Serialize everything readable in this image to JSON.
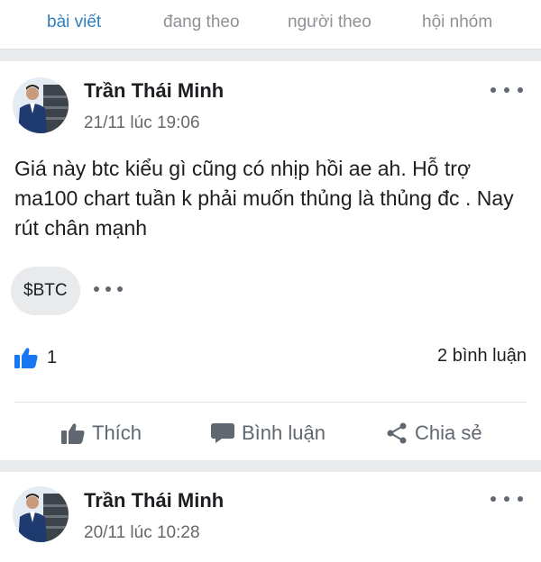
{
  "tabs": [
    {
      "label": "bài viết",
      "active": true
    },
    {
      "label": "đang theo",
      "active": false
    },
    {
      "label": "người theo",
      "active": false
    },
    {
      "label": "hội nhóm",
      "active": false
    }
  ],
  "posts": [
    {
      "author": "Trần Thái Minh",
      "timestamp": "21/11 lúc 19:06",
      "text": "Giá này btc kiểu gì cũng có nhịp hồi ae ah. Hỗ trợ ma100 chart tuần k phải muốn thủng là thủng đc . Nay rút chân mạnh",
      "tag": "$BTC",
      "like_count": "1",
      "comment_count": "2 bình luận"
    },
    {
      "author": "Trần Thái Minh",
      "timestamp": "20/11 lúc 10:28"
    }
  ],
  "actions": {
    "like": "Thích",
    "comment": "Bình luận",
    "share": "Chia sẻ"
  },
  "colors": {
    "accent": "#2f7fc0",
    "like_icon": "#1877f2",
    "background": "#e9eaec"
  },
  "icons": [
    "more-icon",
    "thumbs-up-icon",
    "comment-icon",
    "share-icon"
  ]
}
